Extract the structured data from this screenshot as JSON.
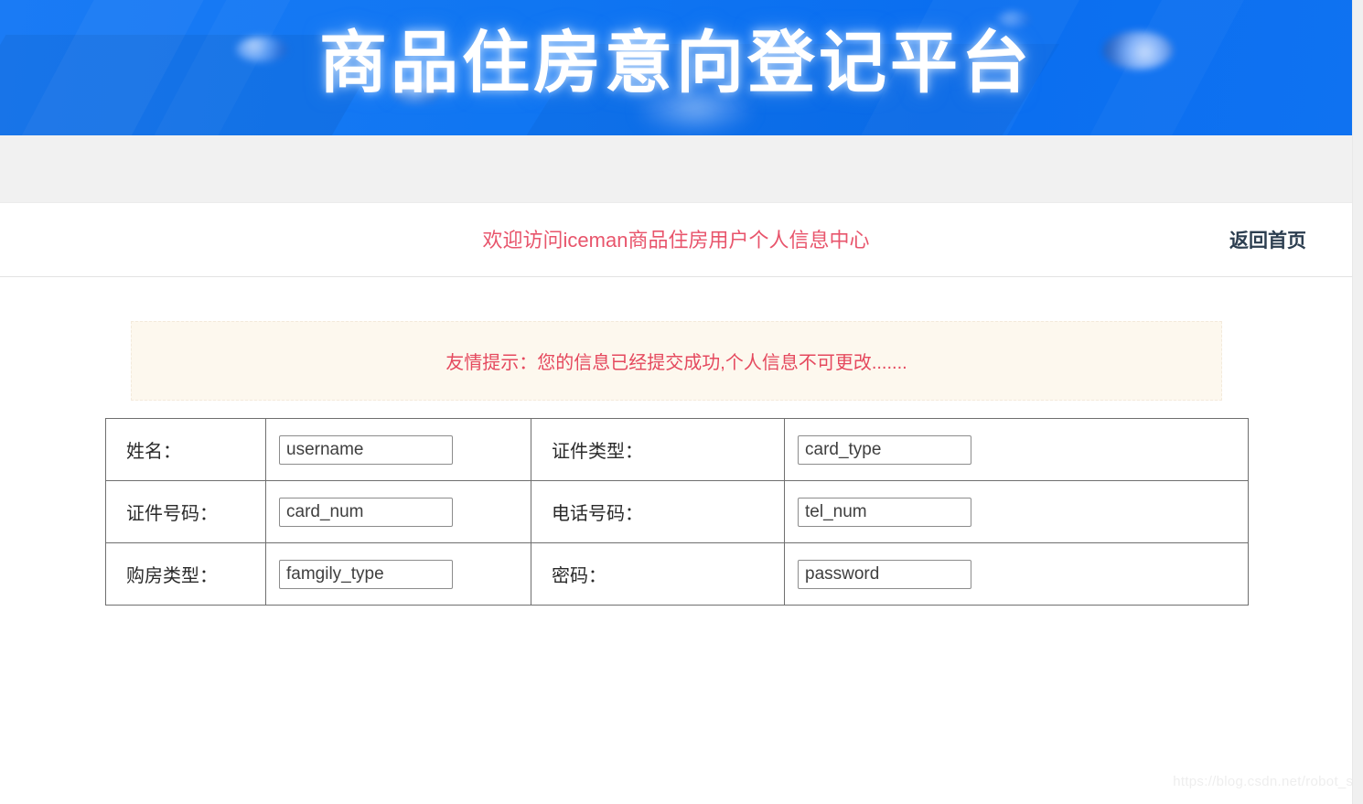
{
  "banner": {
    "title": "商品住房意向登记平台",
    "background_color": "#0f72f1"
  },
  "header": {
    "welcome_text": "欢迎访问iceman商品住房用户个人信息中心",
    "welcome_color": "#e8556c",
    "home_link_label": "返回首页"
  },
  "alert": {
    "message": "友情提示：您的信息已经提交成功,个人信息不可更改.......",
    "text_color": "#e5495e",
    "background_color": "#fdf8ee"
  },
  "form": {
    "rows": [
      {
        "left_label": "姓名：",
        "left_value": "username",
        "right_label": "证件类型：",
        "right_value": "card_type"
      },
      {
        "left_label": "证件号码：",
        "left_value": "card_num",
        "right_label": "电话号码：",
        "right_value": "tel_num"
      },
      {
        "left_label": "购房类型：",
        "left_value": "famgily_type",
        "right_label": "密码：",
        "right_value": "password"
      }
    ]
  },
  "watermark": {
    "text": "https://blog.csdn.net/robot_sh"
  }
}
